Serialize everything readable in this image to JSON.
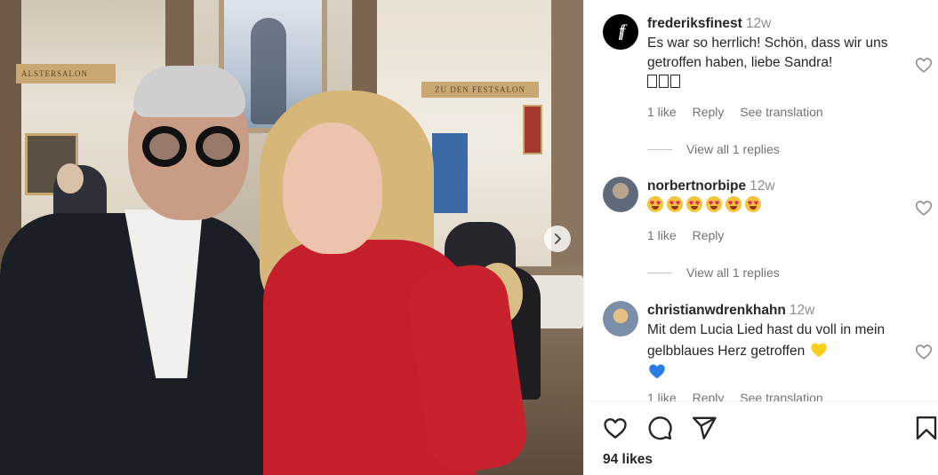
{
  "photo": {
    "banner_left": "ALSTERSALON",
    "banner_right": "ZU DEN FESTSALON",
    "next_button_icon": "chevron-right-icon"
  },
  "comments": [
    {
      "username": "frederiksfinest",
      "time": "12w",
      "avatar_text": "ff",
      "text": "Es war so herrlich! Schön, dass wir uns getroffen haben, liebe Sandra!",
      "trailing_glyph_count": 3,
      "likes": "1 like",
      "reply": "Reply",
      "translation": "See translation",
      "view_replies": "View all 1 replies"
    },
    {
      "username": "norbertnorbipe",
      "time": "12w",
      "emoji": "star-struck-emoji",
      "emoji_count": 6,
      "likes": "1 like",
      "reply": "Reply",
      "view_replies": "View all 1 replies"
    },
    {
      "username": "christianwdrenkhahn",
      "time": "12w",
      "text": "Mit dem Lucia Lied hast du voll in mein gelbblaues Herz getroffen",
      "hearts": [
        "yellow-heart",
        "blue-heart"
      ],
      "likes": "1 like",
      "reply": "Reply",
      "translation": "See translation"
    }
  ],
  "actions": {
    "icons": [
      "heart-icon",
      "comment-icon",
      "share-icon",
      "bookmark-icon"
    ],
    "likes_count": "94 likes"
  },
  "colors": {
    "text": "#262626",
    "muted": "#737373",
    "time": "#8e8e8e",
    "heart_yellow": "#f9cf1c",
    "heart_blue": "#2a7be4"
  }
}
